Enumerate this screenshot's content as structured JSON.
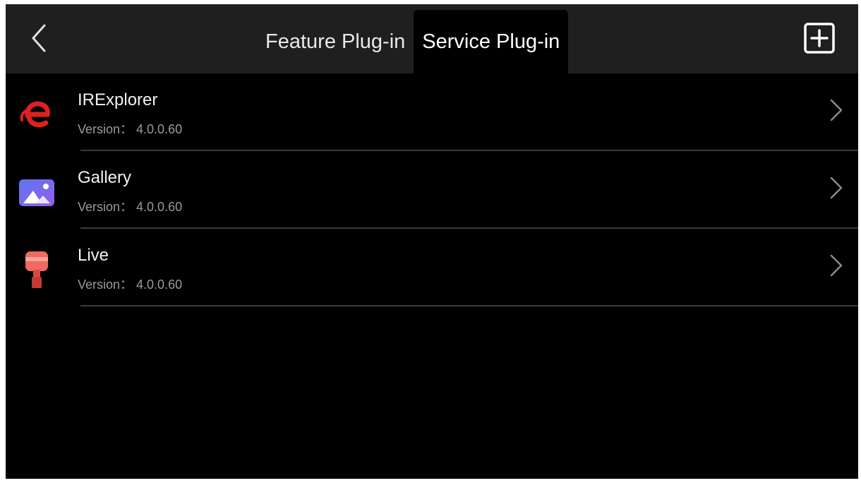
{
  "header": {
    "back_icon": "chevron-left-icon",
    "add_icon": "plus-square-icon",
    "tabs": [
      {
        "label": "Feature Plug-in",
        "active": false
      },
      {
        "label": "Service Plug-in",
        "active": true
      }
    ]
  },
  "plugins": [
    {
      "name": "IRExplorer",
      "version": "Version： 4.0.0.60",
      "icon": "irexplorer-logo-icon",
      "icon_color": "#e02020"
    },
    {
      "name": "Gallery",
      "version": "Version： 4.0.0.60",
      "icon": "gallery-image-icon",
      "icon_color": "#7a6cf0"
    },
    {
      "name": "Live",
      "version": "Version： 4.0.0.60",
      "icon": "live-pin-icon",
      "icon_color": "#e9605a"
    }
  ],
  "colors": {
    "background": "#000000",
    "topbar": "#1f1f1f",
    "text_primary": "#f2f2f2",
    "text_secondary": "#9a9a9a",
    "divider": "#3a3a3a"
  }
}
